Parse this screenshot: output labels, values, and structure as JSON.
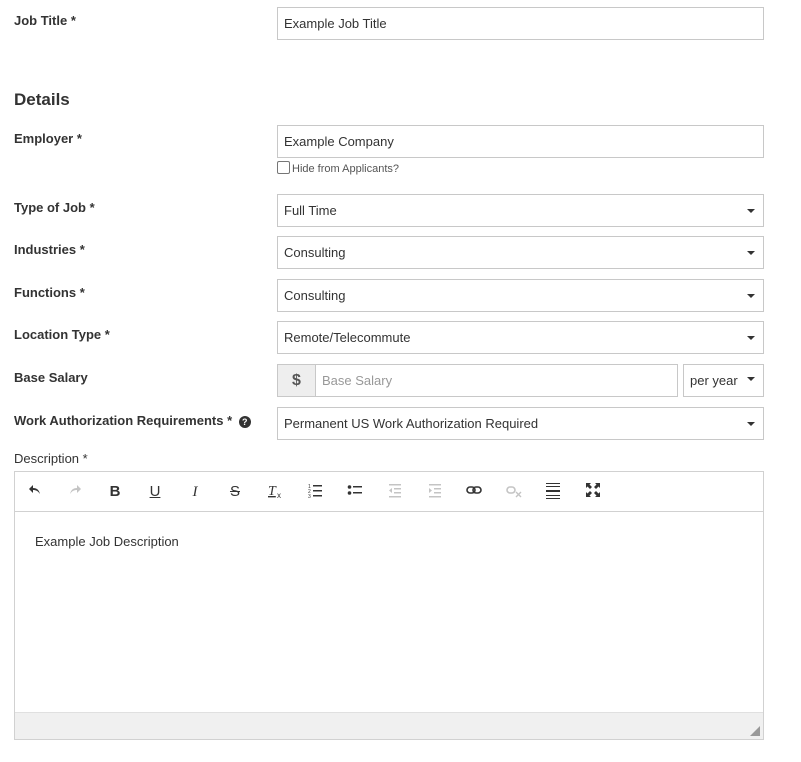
{
  "job_title": {
    "label": "Job Title *",
    "value": "Example Job Title"
  },
  "details": {
    "heading": "Details",
    "employer": {
      "label": "Employer *",
      "value": "Example Company",
      "hide_label": "Hide from Applicants?"
    },
    "type_of_job": {
      "label": "Type of Job *",
      "value": "Full Time"
    },
    "industries": {
      "label": "Industries *",
      "value": "Consulting"
    },
    "functions": {
      "label": "Functions *",
      "value": "Consulting"
    },
    "location_type": {
      "label": "Location Type *",
      "value": "Remote/Telecommute"
    },
    "base_salary": {
      "label": "Base Salary",
      "currency": "$",
      "placeholder": "Base Salary",
      "period": "per year"
    },
    "work_auth": {
      "label": "Work Authorization Requirements *",
      "help_glyph": "?",
      "value": "Permanent US Work Authorization Required"
    },
    "description": {
      "label": "Description *",
      "body": "Example Job Description"
    }
  },
  "toolbar_icons": [
    "undo-icon",
    "redo-icon",
    "bold-icon",
    "underline-icon",
    "italic-icon",
    "strikethrough-icon",
    "remove-format-icon",
    "numbered-list-icon",
    "bulleted-list-icon",
    "outdent-icon",
    "indent-icon",
    "link-icon",
    "unlink-icon",
    "horizontal-rule-icon",
    "maximize-icon"
  ]
}
